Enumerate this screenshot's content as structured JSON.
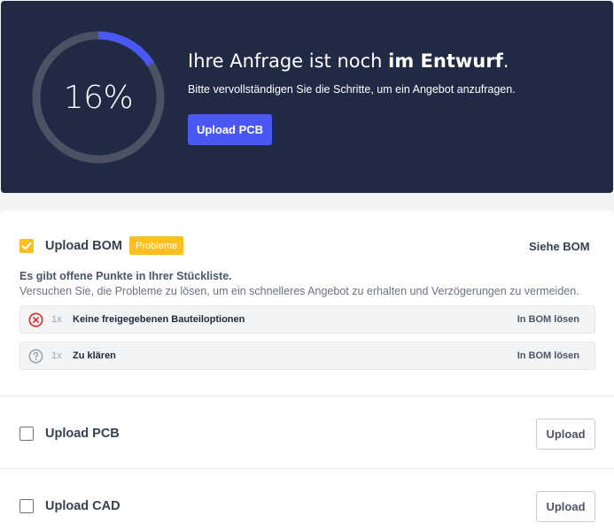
{
  "hero": {
    "progress_percent": 16,
    "progress_label": "16%",
    "title_prefix": "Ihre Anfrage ist noch ",
    "title_bold": "im Entwurf",
    "title_suffix": ".",
    "subtitle": "Bitte vervollständigen Sie die Schritte, um ein Angebot anzufragen.",
    "button_label": "Upload PCB",
    "colors": {
      "background": "#212a45",
      "ring_track": "#4b5263",
      "ring_fill": "#4a57f2",
      "button": "#4a57f2"
    }
  },
  "steps": {
    "bom": {
      "title": "Upload BOM",
      "checked": true,
      "badge": "Probleme",
      "action_label": "Siehe BOM",
      "info_bold": "Es gibt offene Punkte in Ihrer Stückliste.",
      "info_text": "Versuchen Sie, die Probleme zu lösen, um ein schnelleres Angebot zu erhalten und Verzögerungen zu vermeiden.",
      "issues": [
        {
          "icon": "error-x-icon",
          "count": "1x",
          "label": "Keine freigegebenen Bauteiloptionen",
          "action": "In BOM lösen"
        },
        {
          "icon": "question-icon",
          "count": "1x",
          "label": "Zu klären",
          "action": "In BOM lösen"
        }
      ]
    },
    "pcb": {
      "title": "Upload PCB",
      "checked": false,
      "button_label": "Upload"
    },
    "cad": {
      "title": "Upload CAD",
      "checked": false,
      "button_label": "Upload"
    }
  },
  "colors": {
    "badge": "#fbbf24",
    "checkbox_checked": "#fbbf24",
    "error": "#dc2626"
  }
}
